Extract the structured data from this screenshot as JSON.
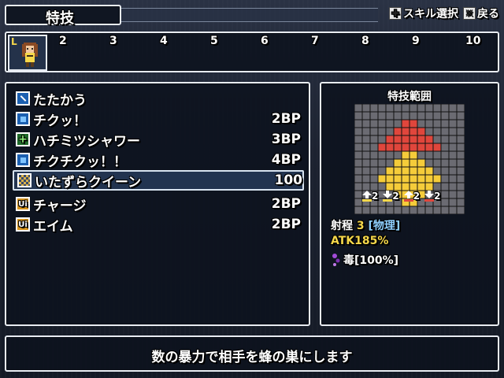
{
  "header": {
    "title": "特技",
    "hints": [
      {
        "icon": "dpad-icon",
        "label": "スキル選択"
      },
      {
        "icon": "x-button-icon",
        "label": "戻る"
      }
    ]
  },
  "party": {
    "active_marker": "L",
    "slots": [
      "2",
      "3",
      "4",
      "5",
      "6",
      "7",
      "8",
      "9",
      "10"
    ]
  },
  "skills": [
    {
      "icon": "attack-icon",
      "name": "たたかう",
      "cost": ""
    },
    {
      "icon": "blue-square-icon",
      "name": "チクッ！",
      "cost": "2BP"
    },
    {
      "icon": "green-cross-icon",
      "name": "ハチミツシャワー",
      "cost": "3BP"
    },
    {
      "icon": "blue-square-icon",
      "name": "チクチクッ！！",
      "cost": "4BP"
    },
    {
      "icon": "checker-icon",
      "name": "いたずらクイーン",
      "cost": "100",
      "selected": true
    },
    {
      "icon": "ui-icon",
      "name": "チャージ",
      "cost": "2BP"
    },
    {
      "icon": "ui-icon",
      "name": "エイム",
      "cost": "2BP"
    }
  ],
  "range": {
    "title": "特技範囲",
    "effects": [
      "2",
      "2",
      "2",
      "2"
    ],
    "range_label": "射程",
    "range_value": "3",
    "range_type": "[物理]",
    "atk": "ATK185%",
    "status": "毒[100%]"
  },
  "description": "数の暴力で相手を蜂の巣にします",
  "colors": {
    "accent_yellow": "#f6d84b",
    "accent_blue": "#8fd0ff",
    "range_red": "#e0463c",
    "range_yellow": "#f5cc3a"
  }
}
